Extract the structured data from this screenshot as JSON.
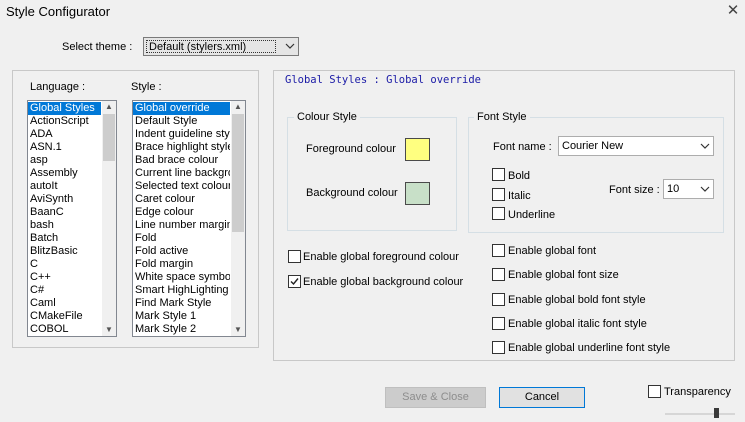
{
  "window": {
    "title": "Style Configurator",
    "close_label": "✕"
  },
  "theme": {
    "label": "Select theme :",
    "value": "Default (stylers.xml)"
  },
  "language": {
    "header": "Language :",
    "items": [
      "Global Styles",
      "ActionScript",
      "ADA",
      "ASN.1",
      "asp",
      "Assembly",
      "autoIt",
      "AviSynth",
      "BaanC",
      "bash",
      "Batch",
      "BlitzBasic",
      "C",
      "C++",
      "C#",
      "Caml",
      "CMakeFile",
      "COBOL"
    ],
    "selected": "Global Styles"
  },
  "style": {
    "header": "Style :",
    "items": [
      "Global override",
      "Default Style",
      "Indent guideline style",
      "Brace highlight style",
      "Bad brace colour",
      "Current line background colour",
      "Selected text colour",
      "Caret colour",
      "Edge colour",
      "Line number margin",
      "Fold",
      "Fold active",
      "Fold margin",
      "White space symbol",
      "Smart HighLighting",
      "Find Mark Style",
      "Mark Style 1",
      "Mark Style 2"
    ],
    "selected": "Global override"
  },
  "detail": {
    "heading": "Global Styles : Global override",
    "colour_style": {
      "label": "Colour Style",
      "fg_label": "Foreground colour",
      "bg_label": "Background colour",
      "fg_color": "#ffff80",
      "bg_color": "#c8e0c8"
    },
    "font_style": {
      "label": "Font Style",
      "name_label": "Font name :",
      "name_value": "Courier New",
      "bold": "Bold",
      "italic": "Italic",
      "underline": "Underline",
      "size_label": "Font size :",
      "size_value": "10"
    },
    "enable_fg": "Enable global foreground colour",
    "enable_bg": "Enable global background colour",
    "enable_font": "Enable global font",
    "enable_size": "Enable global font size",
    "enable_bold": "Enable global bold font style",
    "enable_italic": "Enable global italic font style",
    "enable_underline": "Enable global underline font style"
  },
  "checks": {
    "bold": false,
    "italic": false,
    "underline": false,
    "enable_fg": false,
    "enable_bg": true,
    "enable_font": false,
    "enable_size": false,
    "enable_bold": false,
    "enable_italic": false,
    "enable_underline": false,
    "transparency": false
  },
  "buttons": {
    "save_close": "Save & Close",
    "cancel": "Cancel"
  },
  "transparency": {
    "label": "Transparency"
  },
  "icons": {
    "dropdown": "chevron-down-icon",
    "close": "close-icon",
    "scroll_up": "scroll-up-arrow-icon",
    "scroll_down": "scroll-down-arrow-icon"
  }
}
